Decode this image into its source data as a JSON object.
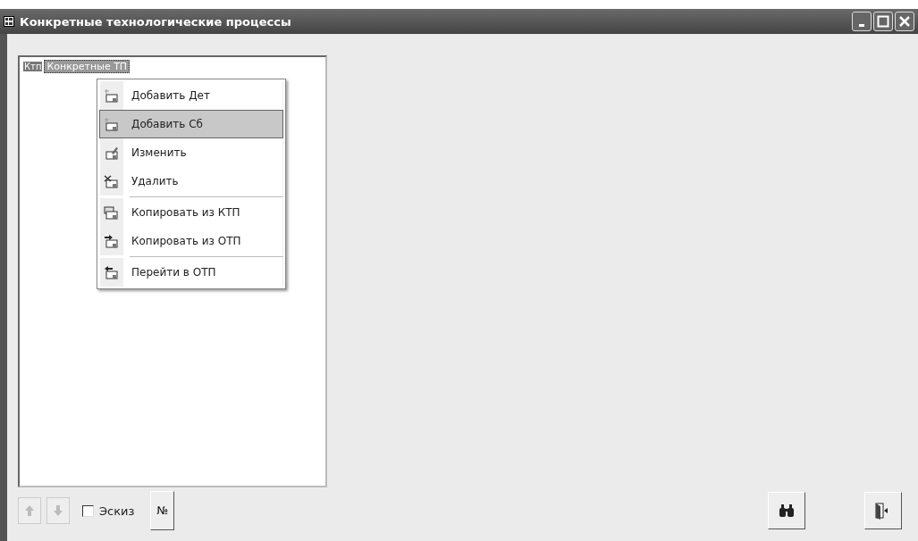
{
  "window": {
    "title": "Конкретные технологические процессы"
  },
  "tree": {
    "items": [
      {
        "tag": "Ктп",
        "label": "Конкретные ТП",
        "selected": true
      }
    ]
  },
  "context_menu": {
    "items": [
      {
        "label": "Добавить Дет",
        "kind": "add",
        "selected": false,
        "separator_before": false
      },
      {
        "label": "Добавить Сб",
        "kind": "add",
        "selected": true,
        "separator_before": false
      },
      {
        "label": "Изменить",
        "kind": "edit",
        "selected": false,
        "separator_before": false
      },
      {
        "label": "Удалить",
        "kind": "delete",
        "selected": false,
        "separator_before": false
      },
      {
        "label": "Копировать из КТП",
        "kind": "copy",
        "selected": false,
        "separator_before": true
      },
      {
        "label": "Копировать из ОТП",
        "kind": "import",
        "selected": false,
        "separator_before": false
      },
      {
        "label": "Перейти в ОТП",
        "kind": "goto",
        "selected": false,
        "separator_before": true
      }
    ]
  },
  "bottom_bar": {
    "sketch_checkbox": {
      "label": "Эскиз",
      "checked": false
    },
    "number_button": {
      "label": "№"
    }
  }
}
